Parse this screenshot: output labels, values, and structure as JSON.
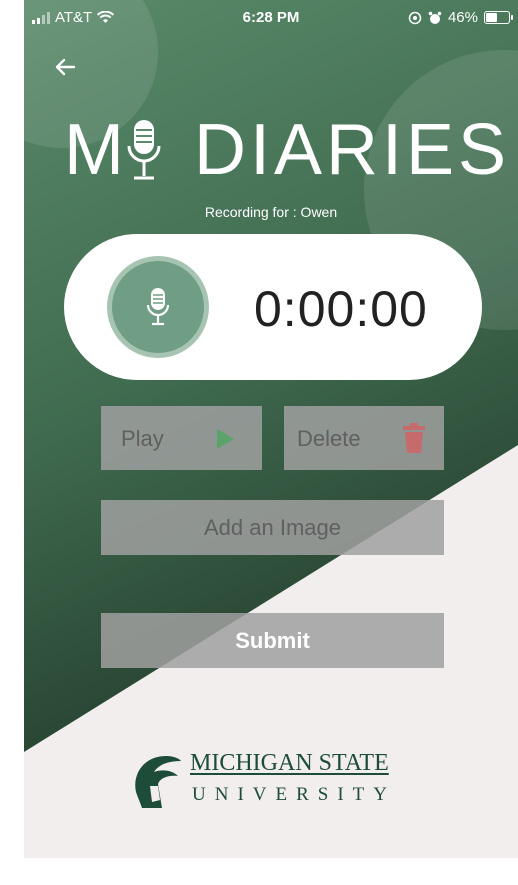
{
  "status_bar": {
    "carrier": "AT&T",
    "time": "6:28 PM",
    "battery": "46%"
  },
  "header": {
    "logo_left": "M",
    "logo_right": "DIARIES",
    "recording_for": "Recording for : Owen"
  },
  "recorder": {
    "timer": "0:00:00"
  },
  "actions": {
    "play_label": "Play",
    "delete_label": "Delete",
    "add_image_label": "Add an Image",
    "submit_label": "Submit"
  },
  "footer": {
    "university_name": "MICHIGAN STATE",
    "university_sub": "UNIVERSITY"
  },
  "colors": {
    "green_dark": "#2c4a36",
    "green_light": "#5d8b6b",
    "mic_green": "#6f9e84",
    "trash_red": "#c56b6b",
    "play_green": "#5aa36a",
    "msu_green": "#1d4d38"
  },
  "icons": {
    "back": "back-arrow-icon",
    "mic": "microphone-icon",
    "play": "play-icon",
    "delete": "trash-icon",
    "logo": "spartan-helmet-icon"
  }
}
